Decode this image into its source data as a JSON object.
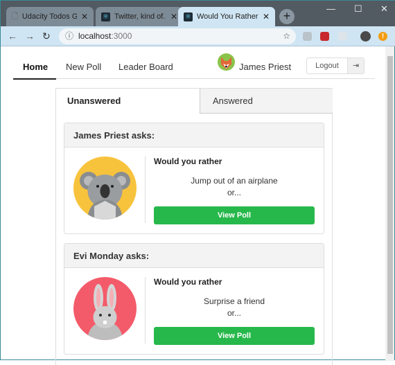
{
  "browser": {
    "tabs": [
      {
        "title": "Udacity Todos Goals"
      },
      {
        "title": "Twitter, kind of."
      },
      {
        "title": "Would You Rather Game"
      }
    ],
    "url_host": "localhost",
    "url_port": ":3000"
  },
  "nav": {
    "items": [
      "Home",
      "New Poll",
      "Leader Board"
    ],
    "user_name": "James Priest",
    "logout_label": "Logout"
  },
  "tabs": {
    "unanswered": "Unanswered",
    "answered": "Answered"
  },
  "polls": [
    {
      "author": "James Priest asks:",
      "prompt": "Would you rather",
      "option": "Jump out of an airplane",
      "or": "or...",
      "button": "View Poll"
    },
    {
      "author": "Evi Monday asks:",
      "prompt": "Would you rather",
      "option": "Surprise a friend",
      "or": "or...",
      "button": "View Poll"
    }
  ],
  "colors": {
    "accent": "#27b84b"
  }
}
